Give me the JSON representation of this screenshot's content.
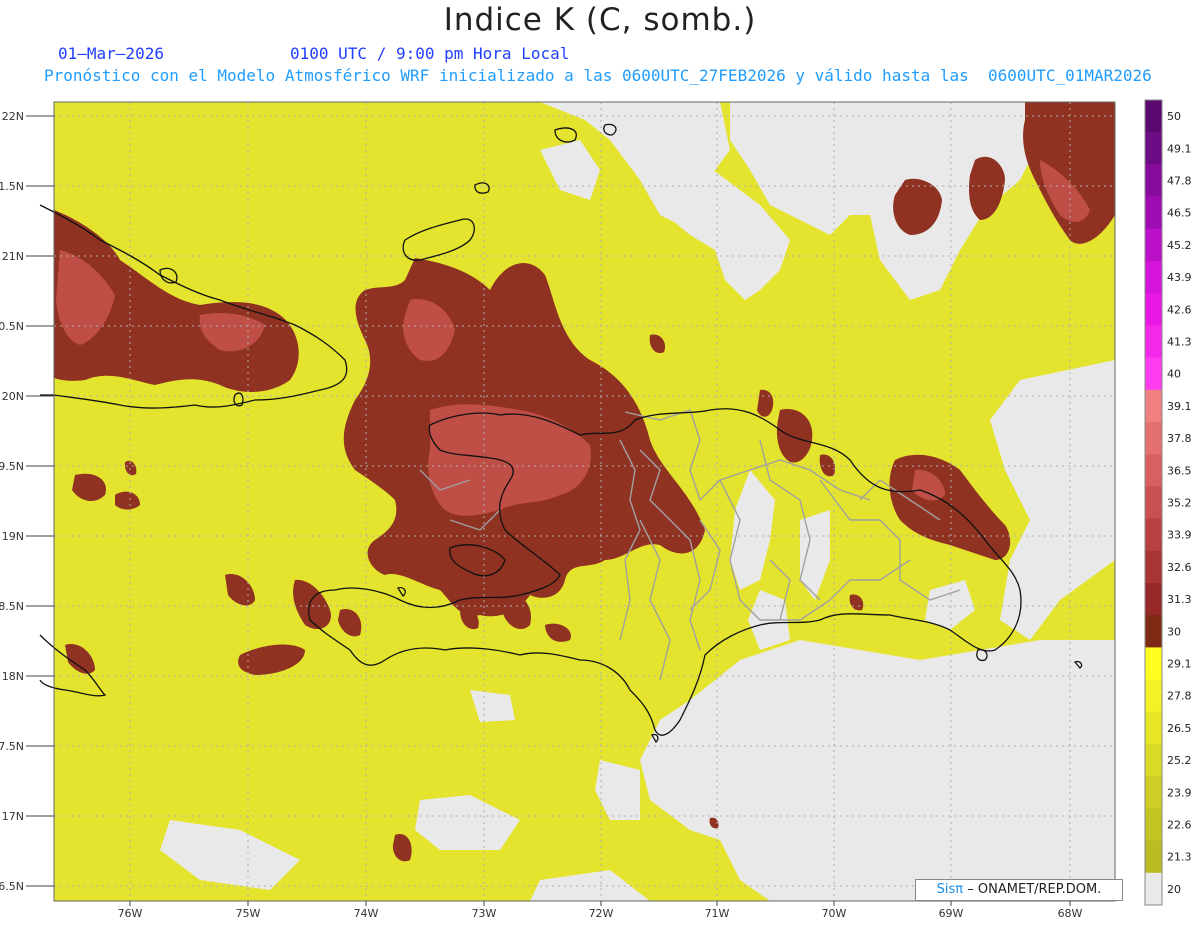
{
  "title": "Indice K (C, somb.)",
  "date": "01–Mar–2026",
  "time": "0100 UTC / 9:00 pm Hora Local",
  "description": "Pronóstico con el Modelo Atmosférico WRF inicializado a las 0600UTC_27FEB2026 y válido hasta las  0600UTC_01MAR2026",
  "credit": {
    "brand": "Sisπ",
    "org": "– ONAMET/REP.DOM."
  },
  "lat_labels": [
    "22N",
    "1.5N",
    "21N",
    "0.5N",
    "20N",
    "9.5N",
    "19N",
    "8.5N",
    "18N",
    "7.5N",
    "17N",
    "6.5N"
  ],
  "lon_labels": [
    "76W",
    "75W",
    "74W",
    "73W",
    "72W",
    "71W",
    "70W",
    "69W",
    "68W"
  ],
  "colorbar": {
    "labels": [
      "50",
      "49.1",
      "47.8",
      "46.5",
      "45.2",
      "43.9",
      "42.6",
      "41.3",
      "40",
      "39.1",
      "37.8",
      "36.5",
      "35.2",
      "33.9",
      "32.6",
      "31.3",
      "30",
      "29.1",
      "27.8",
      "26.5",
      "25.2",
      "23.9",
      "22.6",
      "21.3",
      "20"
    ],
    "colors": [
      "#5a0a6e",
      "#6e0c85",
      "#880c9c",
      "#a00cb4",
      "#bc10c8",
      "#d414d8",
      "#e818e4",
      "#f428e8",
      "#ff3cf0",
      "#f08080",
      "#e47070",
      "#d86060",
      "#c85050",
      "#b84040",
      "#a83434",
      "#962828",
      "#7e2a14",
      "#ffff20",
      "#f2f224",
      "#e6e626",
      "#dada28",
      "#cece26",
      "#c4c424",
      "#baba22",
      "#e9e9e9"
    ]
  },
  "colors": {
    "field": "#e4e42e",
    "strong": "#8f3222",
    "core": "#c7544c",
    "nodata": "#e9e9e9",
    "coast": "#111111",
    "borders": "#a0a0a0"
  }
}
